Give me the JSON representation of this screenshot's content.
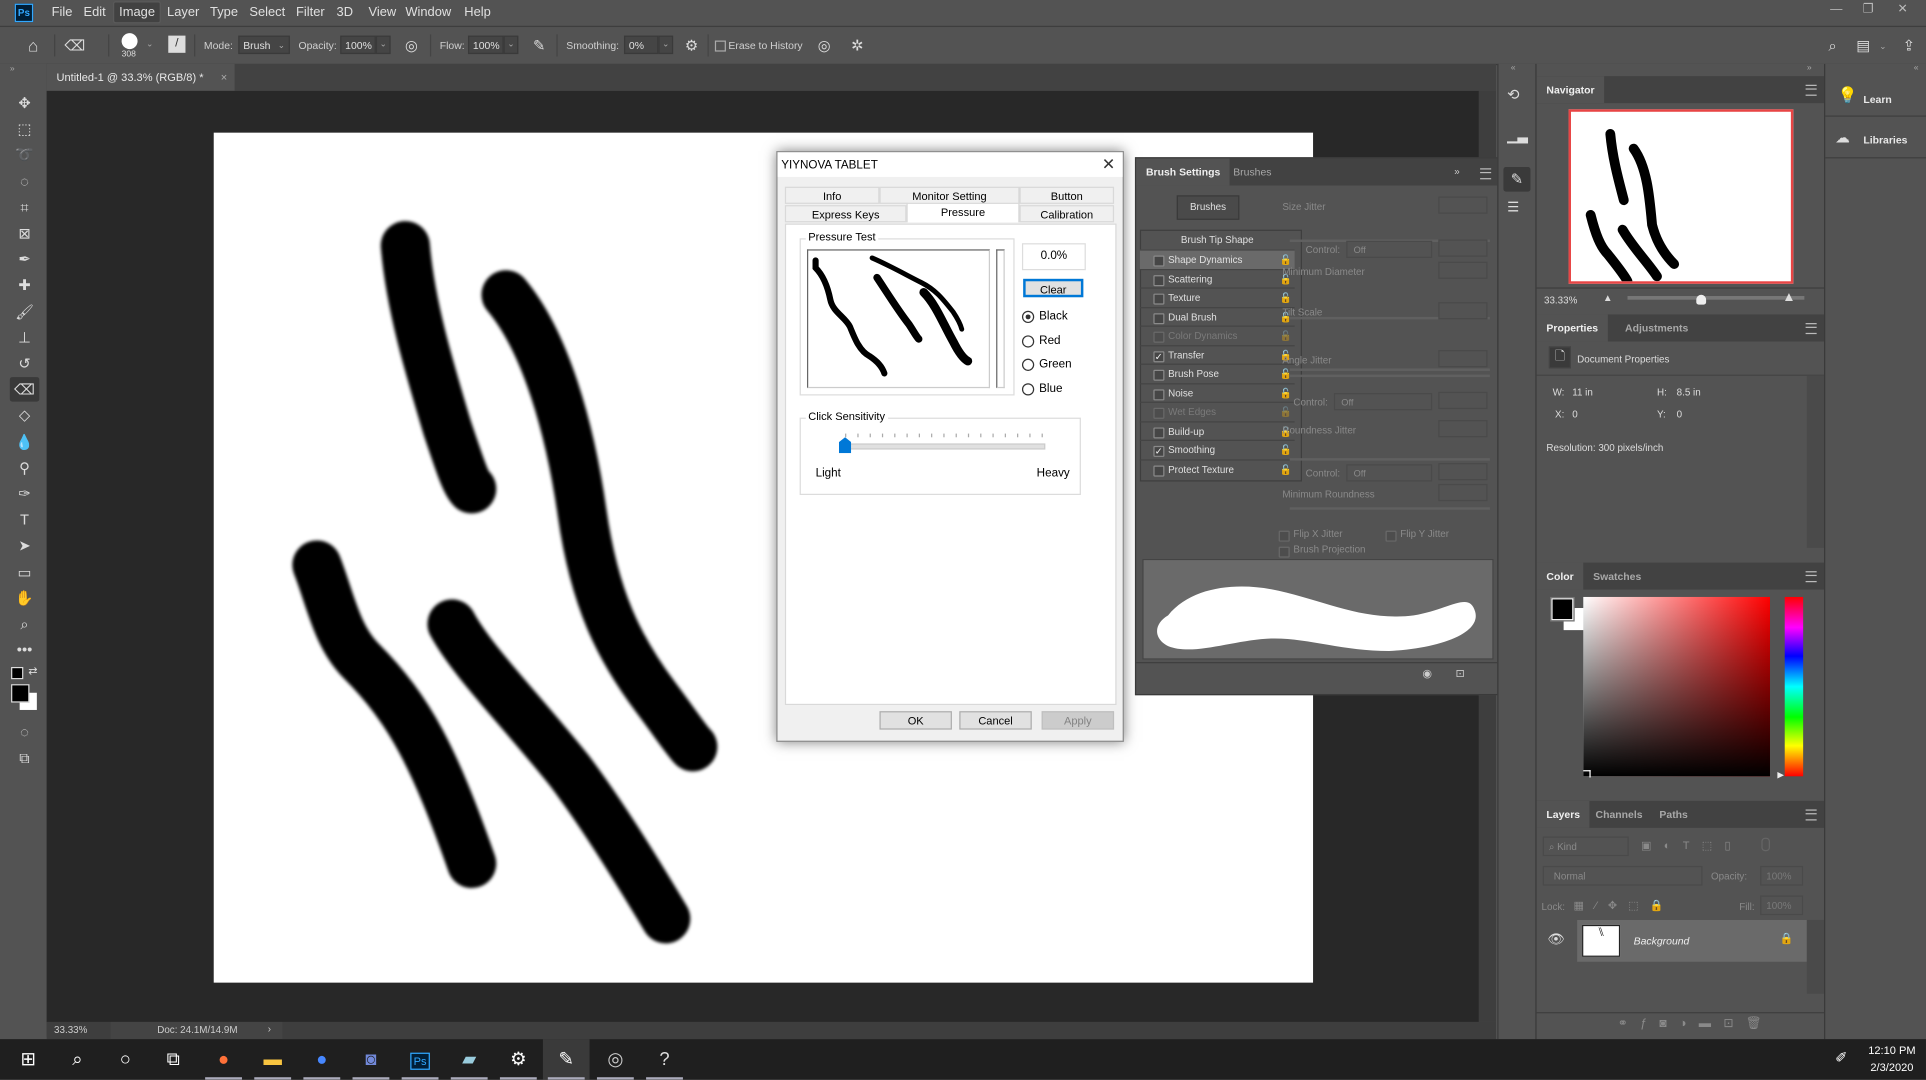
{
  "app": {
    "logo": "Ps",
    "accent": "#31a8ff"
  },
  "menu": [
    "File",
    "Edit",
    "Image",
    "Layer",
    "Type",
    "Select",
    "Filter",
    "3D",
    "View",
    "Window",
    "Help"
  ],
  "menu_active": "Image",
  "window_controls": {
    "minimize": "—",
    "restore": "❐",
    "close": "✕"
  },
  "options": {
    "brush_size": "308",
    "mode_label": "Mode:",
    "mode_value": "Brush",
    "opacity_label": "Opacity:",
    "opacity_value": "100%",
    "flow_label": "Flow:",
    "flow_value": "100%",
    "smoothing_label": "Smoothing:",
    "smoothing_value": "0%",
    "erase_to_history": "Erase to History"
  },
  "document_tab": {
    "title": "Untitled-1 @ 33.3% (RGB/8) *",
    "close": "×"
  },
  "status": {
    "zoom": "33.33%",
    "doc": "Doc: 24.1M/14.9M",
    "arrow": "›"
  },
  "dialog": {
    "title": "YIYNOVA TABLET",
    "close": "✕",
    "tabs_row1": [
      "Info",
      "Monitor Setting",
      "Button"
    ],
    "tabs_row2": [
      "Express Keys",
      "Pressure",
      "Calibration"
    ],
    "selected_tab": "Pressure",
    "pressure_test_label": "Pressure Test",
    "pressure_value": "0.0%",
    "clear_label": "Clear",
    "colors": [
      {
        "label": "Black",
        "checked": true
      },
      {
        "label": "Red",
        "checked": false
      },
      {
        "label": "Green",
        "checked": false
      },
      {
        "label": "Blue",
        "checked": false
      }
    ],
    "click_sensitivity_label": "Click Sensitivity",
    "slider_min_label": "Light",
    "slider_max_label": "Heavy",
    "slider_position": 0,
    "slider_ticks": 17,
    "ok": "OK",
    "cancel": "Cancel",
    "apply": "Apply"
  },
  "brush_settings": {
    "tabs": [
      "Brush Settings",
      "Brushes"
    ],
    "brushes_button": "Brushes",
    "tip_shape": "Brush Tip Shape",
    "options": [
      {
        "label": "Shape Dynamics",
        "checked": false,
        "enabled": true,
        "highlight": true
      },
      {
        "label": "Scattering",
        "checked": false,
        "enabled": true
      },
      {
        "label": "Texture",
        "checked": false,
        "enabled": true
      },
      {
        "label": "Dual Brush",
        "checked": false,
        "enabled": true
      },
      {
        "label": "Color Dynamics",
        "checked": false,
        "enabled": false
      },
      {
        "label": "Transfer",
        "checked": true,
        "enabled": true
      },
      {
        "label": "Brush Pose",
        "checked": false,
        "enabled": true
      },
      {
        "label": "Noise",
        "checked": false,
        "enabled": true
      },
      {
        "label": "Wet Edges",
        "checked": false,
        "enabled": false
      },
      {
        "label": "Build-up",
        "checked": false,
        "enabled": true
      },
      {
        "label": "Smoothing",
        "checked": true,
        "enabled": true
      },
      {
        "label": "Protect Texture",
        "checked": false,
        "enabled": true
      }
    ],
    "params": {
      "size_jitter": "Size Jitter",
      "control": "Control:",
      "off": "Off",
      "min_diameter": "Minimum Diameter",
      "tilt_scale": "Tilt Scale",
      "angle_jitter": "Angle Jitter",
      "roundness_jitter": "Roundness Jitter",
      "min_roundness": "Minimum Roundness",
      "flip_x": "Flip X Jitter",
      "flip_y": "Flip Y Jitter",
      "projection": "Brush Projection"
    }
  },
  "navigator": {
    "title": "Navigator",
    "zoom": "33.33%",
    "slider_position": 0.42
  },
  "properties": {
    "tabs": [
      "Properties",
      "Adjustments"
    ],
    "heading": "Document Properties",
    "w_label": "W:",
    "w": "11 in",
    "h_label": "H:",
    "h": "8.5 in",
    "x_label": "X:",
    "x": "0",
    "y_label": "Y:",
    "y": "0",
    "resolution": "Resolution: 300 pixels/inch"
  },
  "color_panel": {
    "tabs": [
      "Color",
      "Swatches"
    ],
    "foreground": "#000000",
    "background": "#ffffff",
    "hue": "#ff0000"
  },
  "layers": {
    "tabs": [
      "Layers",
      "Channels",
      "Paths"
    ],
    "kind": "Kind",
    "blend": "Normal",
    "opacity_label": "Opacity:",
    "opacity": "100%",
    "lock_label": "Lock:",
    "fill_label": "Fill:",
    "fill": "100%",
    "items": [
      {
        "name": "Background",
        "visible": true,
        "locked": true
      }
    ]
  },
  "learn_panel": {
    "learn": "Learn",
    "libraries": "Libraries"
  },
  "taskbar": {
    "apps": [
      "Firefox",
      "File Explorer",
      "Nord",
      "Discord",
      "Photoshop",
      "Notepad",
      "Settings",
      "Tablet Driver",
      "App",
      "App 2"
    ],
    "time": "12:10 PM",
    "date": "2/3/2020"
  }
}
